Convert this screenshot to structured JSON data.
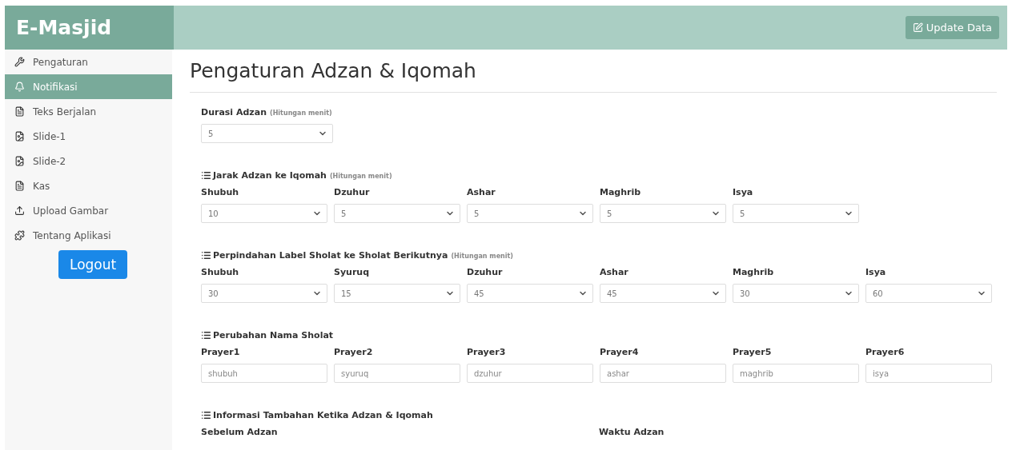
{
  "brand": "E-Masjid",
  "update_button": "Update Data",
  "sidebar": {
    "items": [
      {
        "label": "Pengaturan",
        "selected": false
      },
      {
        "label": "Notifikasi",
        "selected": true
      },
      {
        "label": "Teks Berjalan",
        "selected": false
      },
      {
        "label": "Slide-1",
        "selected": false
      },
      {
        "label": "Slide-2",
        "selected": false
      },
      {
        "label": "Kas",
        "selected": false
      },
      {
        "label": "Upload Gambar",
        "selected": false
      },
      {
        "label": "Tentang Aplikasi",
        "selected": false
      }
    ],
    "logout": "Logout"
  },
  "page_title": "Pengaturan Adzan & Iqomah",
  "durasi": {
    "label": "Durasi Adzan",
    "hint": "(Hitungan menit)",
    "value": "5"
  },
  "sections": [
    {
      "title": "Jarak Adzan ke Iqomah",
      "hint": "(Hitungan menit)",
      "kind": "select",
      "fields": [
        {
          "label": "Shubuh",
          "value": "10"
        },
        {
          "label": "Dzuhur",
          "value": "5"
        },
        {
          "label": "Ashar",
          "value": "5"
        },
        {
          "label": "Maghrib",
          "value": "5"
        },
        {
          "label": "Isya",
          "value": "5"
        }
      ]
    },
    {
      "title": "Perpindahan Label Sholat ke Sholat Berikutnya",
      "hint": "(Hitungan menit)",
      "kind": "select",
      "fields": [
        {
          "label": "Shubuh",
          "value": "30"
        },
        {
          "label": "Syuruq",
          "value": "15"
        },
        {
          "label": "Dzuhur",
          "value": "45"
        },
        {
          "label": "Ashar",
          "value": "45"
        },
        {
          "label": "Maghrib",
          "value": "30"
        },
        {
          "label": "Isya",
          "value": "60"
        }
      ]
    },
    {
      "title": "Perubahan Nama Sholat",
      "kind": "text",
      "fields": [
        {
          "label": "Prayer1",
          "value": "shubuh"
        },
        {
          "label": "Prayer2",
          "value": "syuruq"
        },
        {
          "label": "Prayer3",
          "value": "dzuhur"
        },
        {
          "label": "Prayer4",
          "value": "ashar"
        },
        {
          "label": "Prayer5",
          "value": "maghrib"
        },
        {
          "label": "Prayer6",
          "value": "isya"
        }
      ]
    },
    {
      "title": "Informasi Tambahan Ketika Adzan & Iqomah",
      "kind": "labels",
      "fields": [
        {
          "label": "Sebelum Adzan"
        },
        {
          "label": "Waktu Adzan"
        }
      ]
    }
  ]
}
